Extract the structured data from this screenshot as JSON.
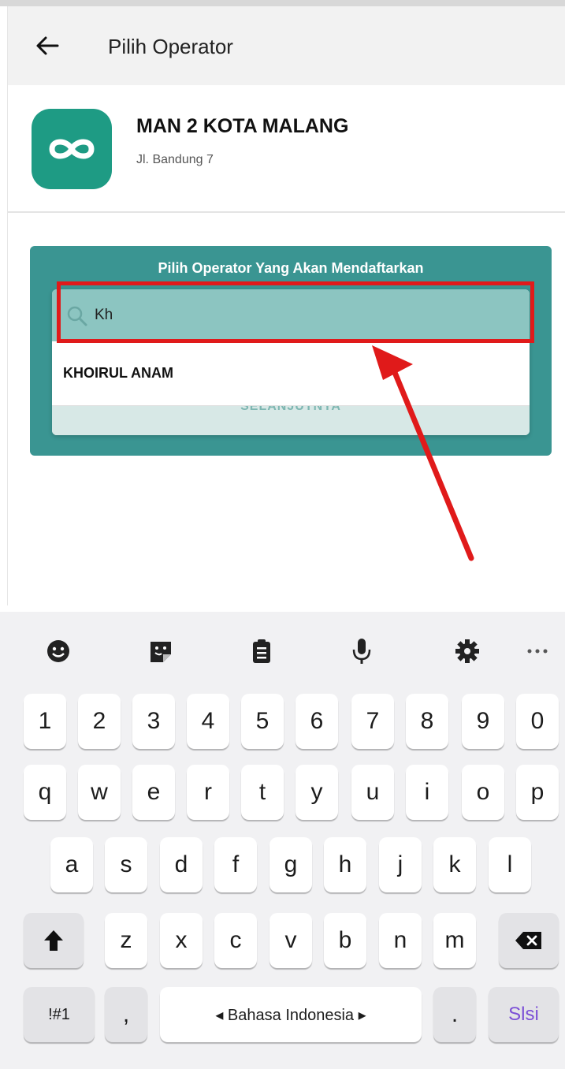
{
  "appbar": {
    "title": "Pilih Operator"
  },
  "school": {
    "name": "MAN 2 KOTA MALANG",
    "address": "Jl. Bandung 7"
  },
  "card": {
    "title": "Pilih Operator Yang Akan Mendaftarkan",
    "search_value": "Kh",
    "results": [
      "KHOIRUL ANAM"
    ],
    "next_button_label": "SELANJUTNYA"
  },
  "colors": {
    "teal": "#3a9592",
    "accent": "#1e9b84",
    "highlight": "#e01a1a",
    "done": "#7b4fd6"
  },
  "keyboard": {
    "tools": [
      "emoji-icon",
      "sticker-icon",
      "clipboard-icon",
      "microphone-icon",
      "gear-icon",
      "more-icon"
    ],
    "numbers": [
      "1",
      "2",
      "3",
      "4",
      "5",
      "6",
      "7",
      "8",
      "9",
      "0"
    ],
    "row1": [
      "q",
      "w",
      "e",
      "r",
      "t",
      "y",
      "u",
      "i",
      "o",
      "p"
    ],
    "row2": [
      "a",
      "s",
      "d",
      "f",
      "g",
      "h",
      "j",
      "k",
      "l"
    ],
    "row3": [
      "z",
      "x",
      "c",
      "v",
      "b",
      "n",
      "m"
    ],
    "symbols_label": "!#1",
    "comma": ",",
    "space_label": "◂ Bahasa Indonesia ▸",
    "period": ".",
    "done_label": "Slsi"
  }
}
